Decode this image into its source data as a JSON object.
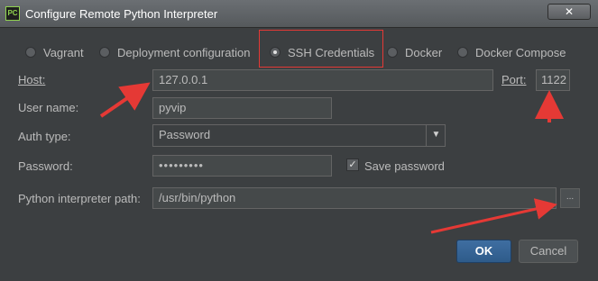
{
  "window": {
    "title": "Configure Remote Python Interpreter",
    "close_label": "✕"
  },
  "connection_types": [
    {
      "label": "Vagrant",
      "selected": false
    },
    {
      "label": "Deployment configuration",
      "selected": false
    },
    {
      "label": "SSH Credentials",
      "selected": true
    },
    {
      "label": "Docker",
      "selected": false
    },
    {
      "label": "Docker Compose",
      "selected": false
    }
  ],
  "form": {
    "host_label": "Host:",
    "host_value": "127.0.0.1",
    "port_label": "Port:",
    "port_value": "1122",
    "username_label": "User name:",
    "username_value": "pyvip",
    "auth_type_label": "Auth type:",
    "auth_type_value": "Password",
    "password_label": "Password:",
    "password_value": "•••••••••",
    "save_password_label": "Save password",
    "save_password_checked": true,
    "interpreter_label": "Python interpreter path:",
    "interpreter_value": "/usr/bin/python",
    "browse_label": "..."
  },
  "buttons": {
    "ok": "OK",
    "cancel": "Cancel"
  },
  "colors": {
    "background": "#3c3f41",
    "annotation": "#e53935",
    "ok_button": "#365880"
  }
}
